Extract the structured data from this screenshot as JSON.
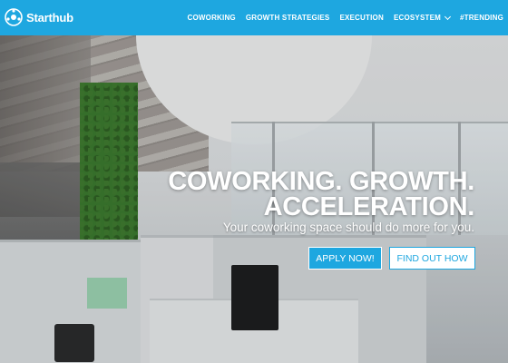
{
  "header": {
    "brand": "Starthub",
    "logo_icon": "starthub-logo-icon",
    "nav": [
      {
        "label": "COWORKING"
      },
      {
        "label": "GROWTH STRATEGIES"
      },
      {
        "label": "EXECUTION"
      },
      {
        "label": "ECOSYSTEM",
        "has_dropdown": true
      },
      {
        "label": "#TRENDING"
      }
    ],
    "colors": {
      "accent": "#1ea7e0",
      "text": "#ffffff"
    }
  },
  "hero": {
    "title_line1": "COWORKING. GROWTH.",
    "title_line2": "ACCELERATION.",
    "subtitle": "Your coworking space should do more for you.",
    "primary_button": "APPLY NOW!",
    "secondary_button": "FIND OUT HOW"
  }
}
